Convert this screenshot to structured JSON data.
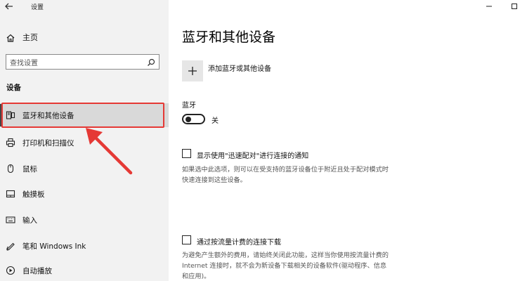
{
  "window": {
    "title": "设置"
  },
  "sidebar": {
    "home_label": "主页",
    "search_placeholder": "查找设置",
    "section_title": "设备",
    "items": [
      {
        "label": "蓝牙和其他设备",
        "icon": "bluetooth-devices-icon",
        "active": true
      },
      {
        "label": "打印机和扫描仪",
        "icon": "printer-icon",
        "active": false
      },
      {
        "label": "鼠标",
        "icon": "mouse-icon",
        "active": false
      },
      {
        "label": "触摸板",
        "icon": "touchpad-icon",
        "active": false
      },
      {
        "label": "输入",
        "icon": "keyboard-icon",
        "active": false
      },
      {
        "label": "笔和 Windows Ink",
        "icon": "pen-icon",
        "active": false
      },
      {
        "label": "自动播放",
        "icon": "autoplay-icon",
        "active": false
      }
    ]
  },
  "main": {
    "title": "蓝牙和其他设备",
    "add_device_label": "添加蓝牙或其他设备",
    "bluetooth": {
      "label": "蓝牙",
      "state_label": "关",
      "on": false
    },
    "swift_pair": {
      "label": "显示使用\"迅速配对\"进行连接的通知",
      "checked": false,
      "desc_line1": "如果选中此选项，则可以在受支持的蓝牙设备位于附近且处于配对模式时",
      "desc_line2": "快速连接到这些设备。"
    },
    "metered": {
      "label": "通过按流量计费的连接下载",
      "checked": false,
      "desc_line1": "为避免产生额外的费用，请始终关闭此功能，这样当你使用按流量计费的",
      "desc_line2": "Internet 连接时，就不会为新设备下载相关的设备软件(驱动程序、信息",
      "desc_line3": "和应用)。"
    }
  },
  "colors": {
    "highlight_red": "#e53935",
    "sidebar_bg": "#f2f2f2",
    "active_bg": "#d9d9d9"
  }
}
